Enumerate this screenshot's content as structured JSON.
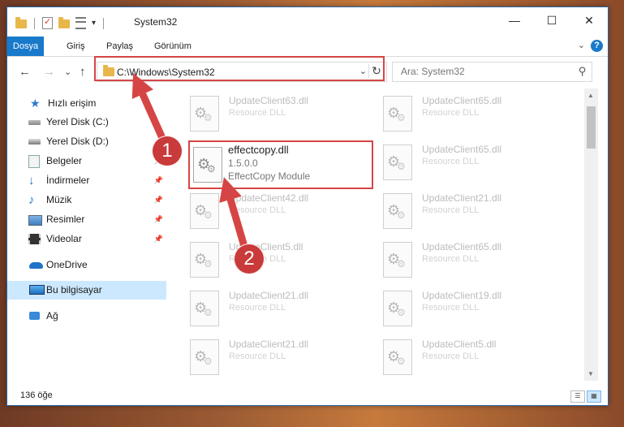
{
  "window": {
    "title": "System32",
    "controls": {
      "minimize": "—",
      "maximize": "☐",
      "close": "✕"
    },
    "quick_access_icons": [
      "folder-icon",
      "properties-icon",
      "new-folder-icon",
      "customize-icon"
    ]
  },
  "ribbon": {
    "tabs": [
      {
        "label": "Dosya"
      },
      {
        "label": "Giriş"
      },
      {
        "label": "Paylaş"
      },
      {
        "label": "Görünüm"
      }
    ],
    "help": "?"
  },
  "nav": {
    "back": "←",
    "forward": "→",
    "recent": "⌄",
    "up": "↑",
    "address_path": "C:\\Windows\\System32",
    "search_placeholder": "Ara: System32"
  },
  "sidebar": {
    "items": [
      {
        "label": "Hızlı erişim",
        "icon": "star-icon"
      },
      {
        "label": "Yerel Disk (C:)",
        "icon": "drive-icon"
      },
      {
        "label": "Yerel Disk (D:)",
        "icon": "drive-icon"
      },
      {
        "label": "Belgeler",
        "icon": "documents-icon",
        "pinned": true
      },
      {
        "label": "İndirmeler",
        "icon": "downloads-icon",
        "pinned": true
      },
      {
        "label": "Müzik",
        "icon": "music-icon",
        "pinned": true
      },
      {
        "label": "Resimler",
        "icon": "pictures-icon",
        "pinned": true
      },
      {
        "label": "Videolar",
        "icon": "videos-icon",
        "pinned": true
      },
      {
        "label": "OneDrive",
        "icon": "onedrive-icon"
      },
      {
        "label": "Bu bilgisayar",
        "icon": "this-pc-icon",
        "selected": true
      },
      {
        "label": "Ağ",
        "icon": "network-icon"
      }
    ]
  },
  "files": {
    "left": [
      {
        "name": "UpdateClient63.dll",
        "desc": "Resource DLL"
      },
      {
        "name": "UpdateClient42.dll",
        "desc": "Resource DLL"
      },
      {
        "name": "UpdateClient5.dll",
        "desc": "Resource DLL"
      },
      {
        "name": "UpdateClient21.dll",
        "desc": "Resource DLL"
      },
      {
        "name": "UpdateClient21.dll",
        "desc": "Resource DLL"
      }
    ],
    "right": [
      {
        "name": "UpdateClient65.dll",
        "desc": "Resource DLL"
      },
      {
        "name": "UpdateClient65.dll",
        "desc": "Resource DLL"
      },
      {
        "name": "UpdateClient21.dll",
        "desc": "Resource DLL"
      },
      {
        "name": "UpdateClient65.dll",
        "desc": "Resource DLL"
      },
      {
        "name": "UpdateClient19.dll",
        "desc": "Resource DLL"
      },
      {
        "name": "UpdateClient5.dll",
        "desc": "Resource DLL"
      }
    ],
    "highlighted": {
      "name": "effectcopy.dll",
      "version": "1.5.0.0",
      "desc": "EffectCopy Module"
    }
  },
  "status": {
    "count": "136 öğe"
  },
  "annotations": {
    "step1": "1",
    "step2": "2",
    "color": "#d64545"
  }
}
